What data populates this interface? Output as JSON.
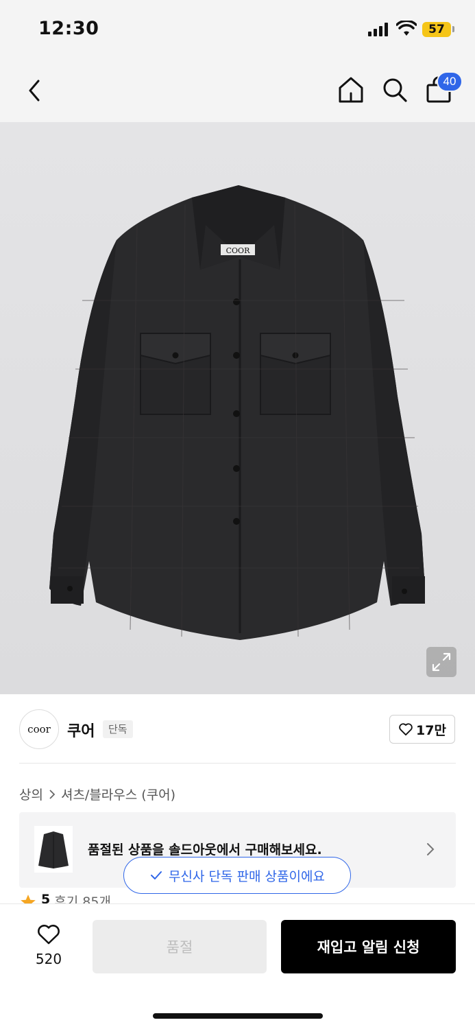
{
  "status_bar": {
    "time": "12:30",
    "battery": "57"
  },
  "nav": {
    "cart_badge": "40"
  },
  "product": {
    "image_alt": "charcoal quilted check shirt jacket",
    "label_text": "COOR"
  },
  "brand": {
    "logo_text": "coor",
    "name": "쿠어",
    "tag": "단독",
    "like_count": "17만"
  },
  "breadcrumb": {
    "items": [
      "상의",
      "셔츠/블라우스 (쿠어)"
    ]
  },
  "banner": {
    "text": "품절된 상품을 솔드아웃에서 구매해보세요."
  },
  "exclusive_notice": "무신사 단독 판매 상품이에요",
  "rating": {
    "score": "5",
    "reviews": "후기 85개"
  },
  "bottom_bar": {
    "wish_count": "520",
    "soldout_label": "품절",
    "restock_label": "재입고 알림 신청"
  },
  "colors": {
    "accent_blue": "#2f66e8",
    "battery_yellow": "#f5c518"
  }
}
